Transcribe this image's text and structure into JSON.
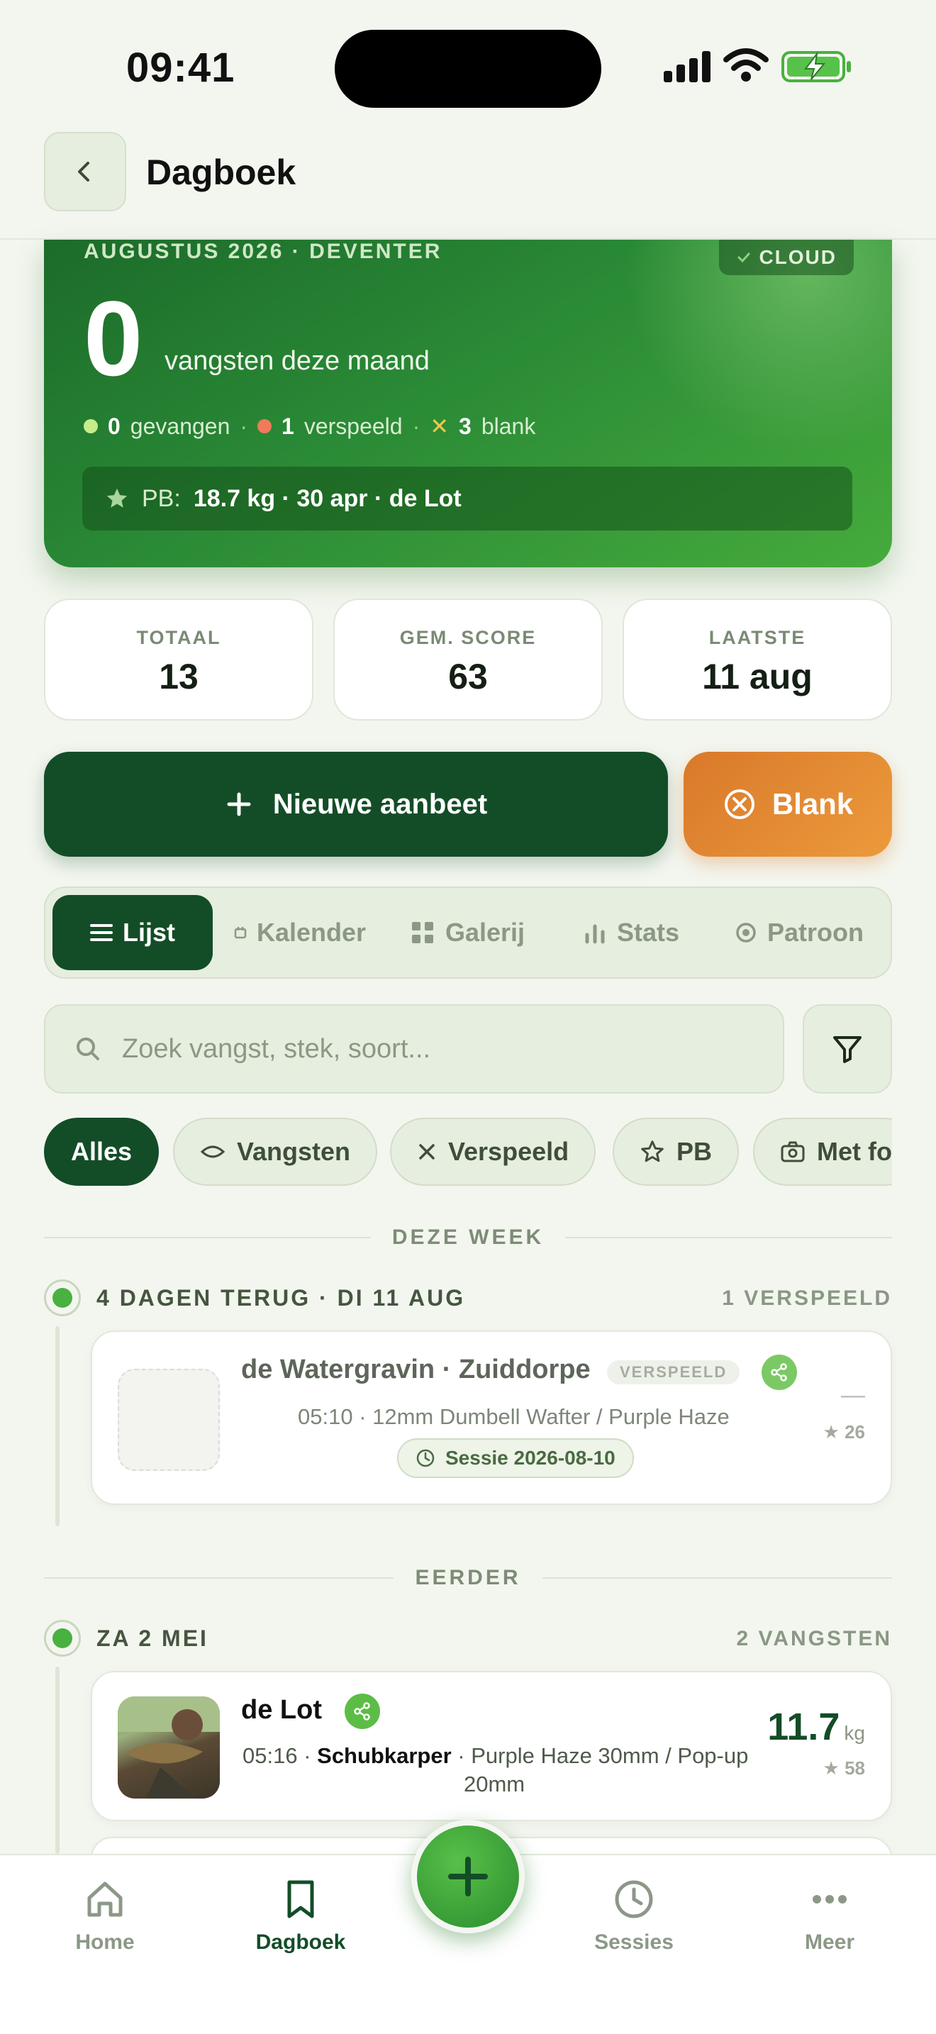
{
  "status_bar": {
    "time": "09:41"
  },
  "header": {
    "title": "Dagboek"
  },
  "hero": {
    "subtitle": "AUGUSTUS 2026 · DEVENTER",
    "cloud_label": "CLOUD",
    "count": "0",
    "count_label": "vangsten deze maand",
    "stats": {
      "caught_count": "0",
      "caught_label": "gevangen",
      "lost_count": "1",
      "lost_label": "verspeeld",
      "blank_count": "3",
      "blank_label": "blank"
    },
    "pb_label": "PB:",
    "pb_value": "18.7 kg · 30 apr · de Lot",
    "colors": {
      "caught": "#c7ec8a",
      "lost": "#f07a5a",
      "blank": "#f3c64a"
    }
  },
  "stat_cards": [
    {
      "label": "TOTAAL",
      "value": "13"
    },
    {
      "label": "GEM. SCORE",
      "value": "63"
    },
    {
      "label": "LAATSTE",
      "value": "11 aug"
    }
  ],
  "actions": {
    "new_label": "Nieuwe aanbeet",
    "blank_label": "Blank"
  },
  "view_tabs": [
    {
      "label": "Lijst",
      "icon": "list-icon"
    },
    {
      "label": "Kalender",
      "icon": "calendar-icon"
    },
    {
      "label": "Galerij",
      "icon": "grid-icon"
    },
    {
      "label": "Stats",
      "icon": "bar-chart-icon"
    },
    {
      "label": "Patroon",
      "icon": "target-icon"
    }
  ],
  "search": {
    "placeholder": "Zoek vangst, stek, soort..."
  },
  "chips": [
    {
      "label": "Alles"
    },
    {
      "label": "Vangsten",
      "icon": "fish-icon"
    },
    {
      "label": "Verspeeld",
      "icon": "x-icon"
    },
    {
      "label": "PB",
      "icon": "star-icon"
    },
    {
      "label": "Met fo",
      "icon": "camera-icon"
    }
  ],
  "sections": {
    "this_week": "DEZE WEEK",
    "earlier": "EERDER"
  },
  "days": [
    {
      "title": "4 DAGEN TERUG · DI 11 AUG",
      "count": "1 VERSPEELD",
      "entries": [
        {
          "title": "de Watergravin · Zuiddorpe",
          "badge": "VERSPEELD",
          "details": "05:10 · 12mm Dumbell Wafter / Purple Haze",
          "session": "Sessie 2026-08-10",
          "weight": "—",
          "score": "★ 26"
        }
      ]
    },
    {
      "title": "ZA 2 MEI",
      "count": "2 VANGSTEN",
      "entries": [
        {
          "title": "de Lot",
          "time": "05:16 ·",
          "species": "Schubkarper",
          "bait": "· Purple Haze 30mm / Pop-up",
          "bait2": "20mm",
          "weight": "11.7",
          "unit": "kg",
          "score": "★ 58"
        }
      ]
    }
  ],
  "bottom_nav": [
    {
      "label": "Home",
      "icon": "home-icon"
    },
    {
      "label": "Dagboek",
      "icon": "bookmark-icon"
    },
    {
      "label": "Sessies",
      "icon": "clock-icon"
    },
    {
      "label": "Meer",
      "icon": "more-icon"
    }
  ]
}
